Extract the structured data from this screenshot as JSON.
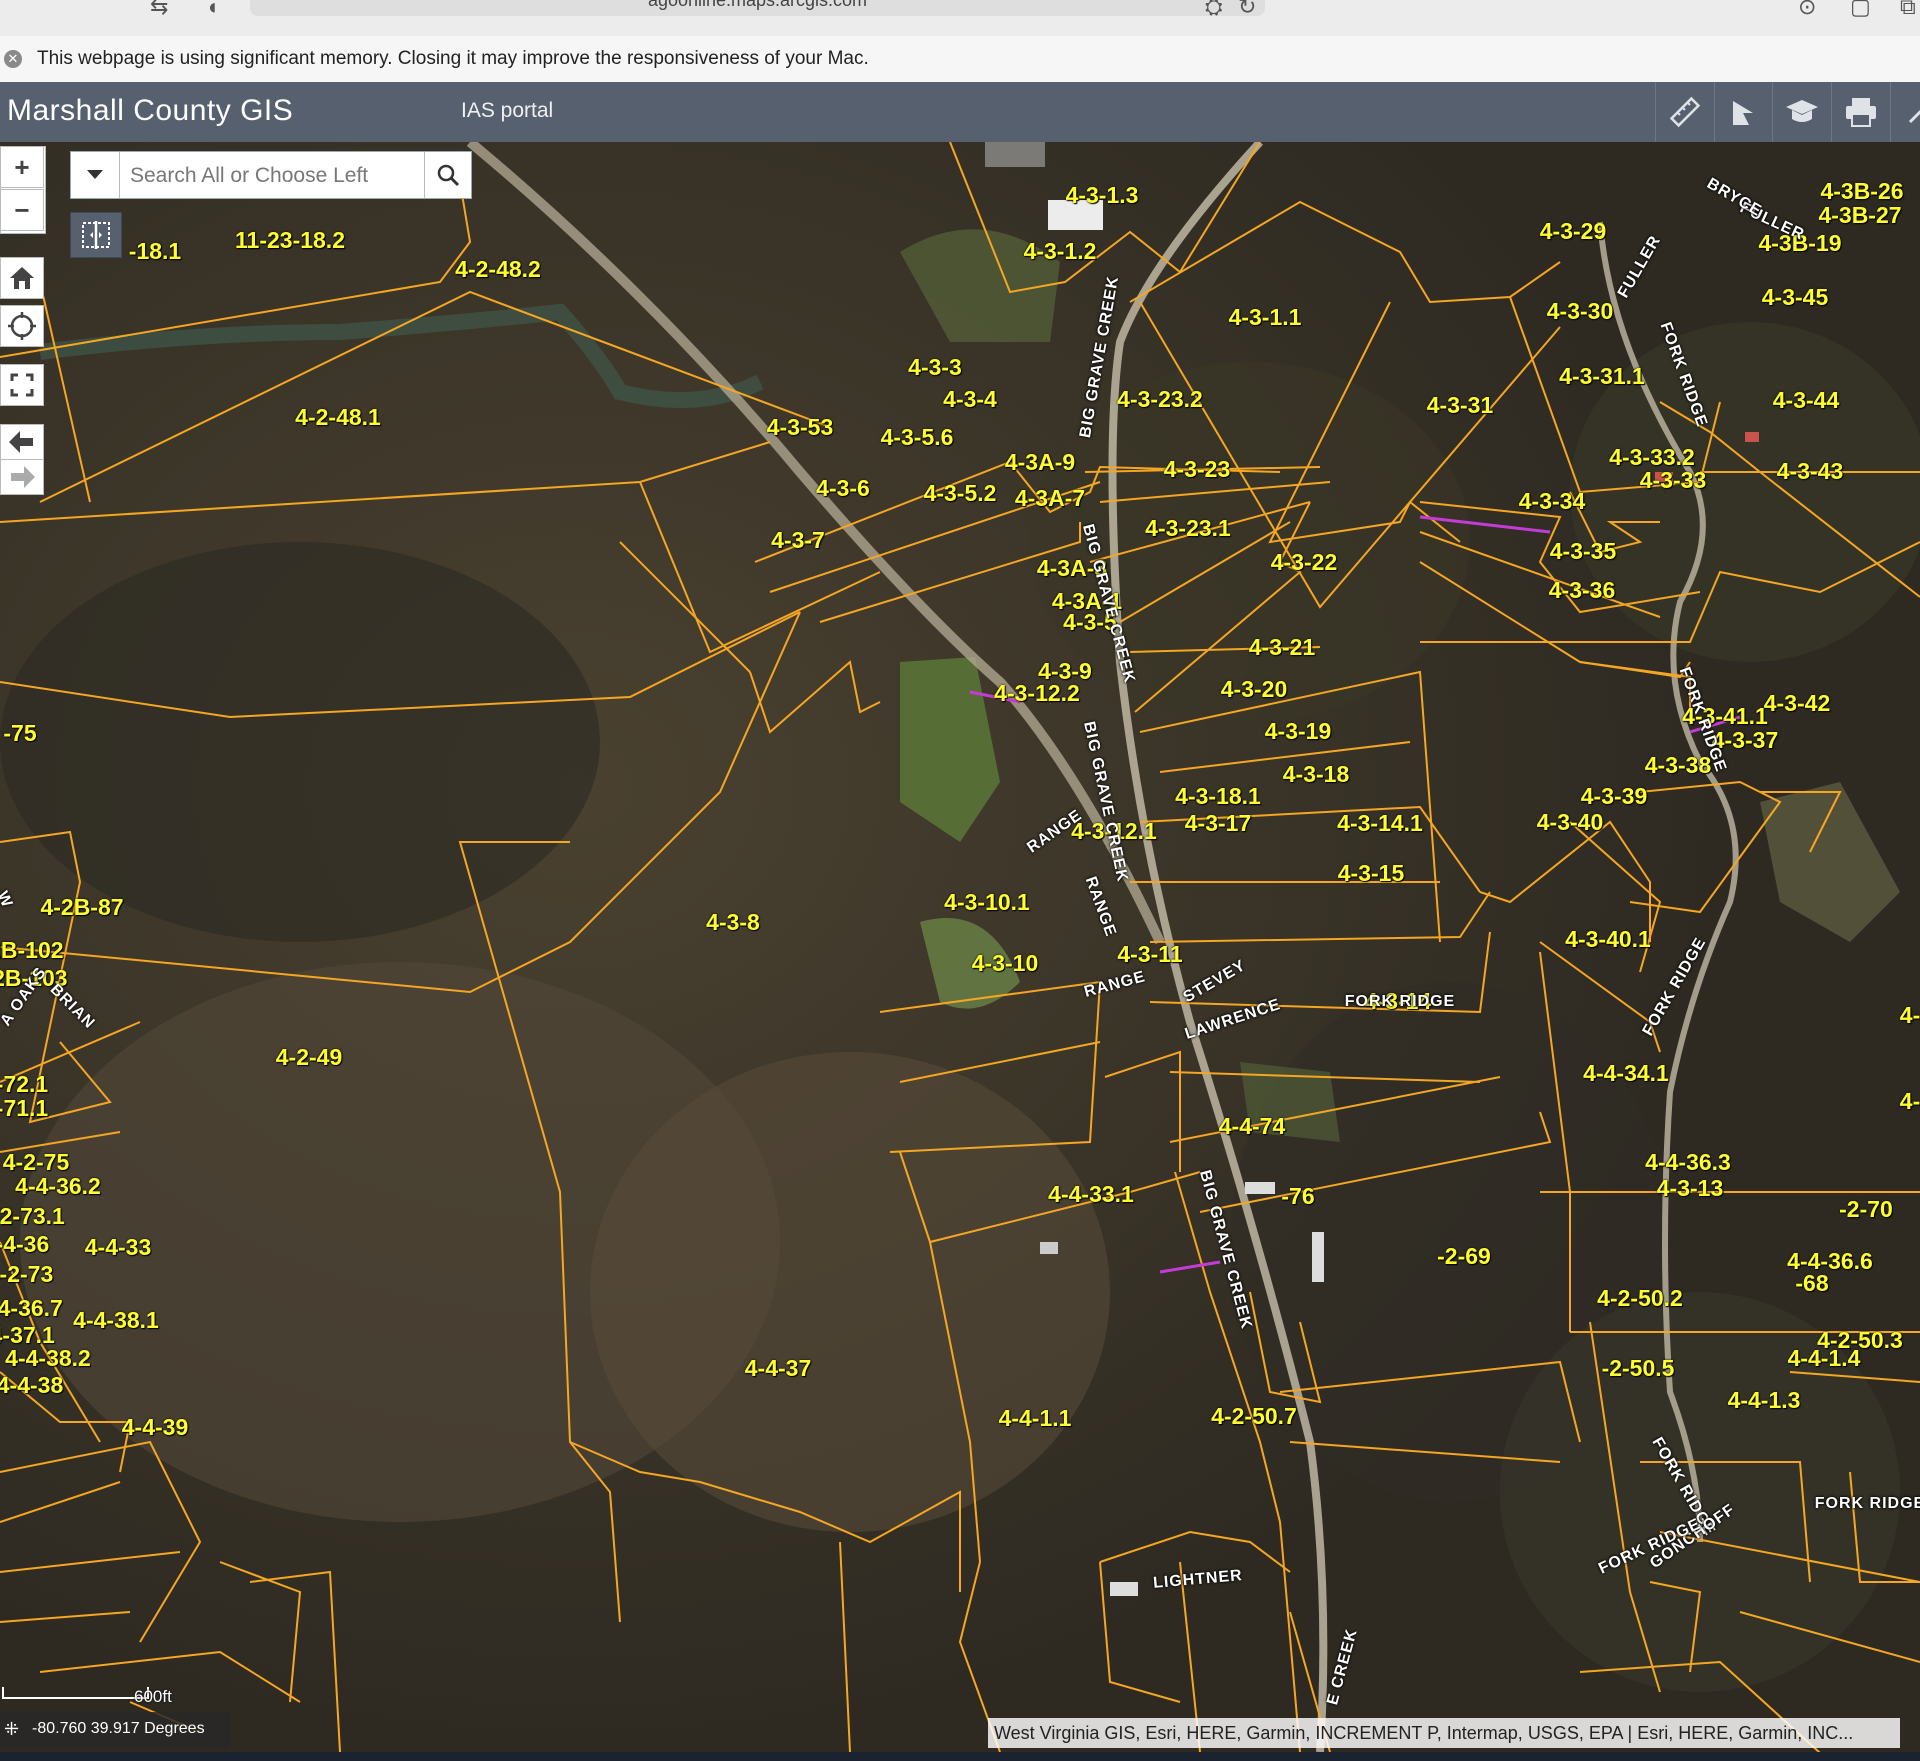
{
  "browser": {
    "url": "agoonline.maps.arcgis.com",
    "notice": "This webpage is using significant memory. Closing it may improve the responsiveness of your Mac."
  },
  "header": {
    "title": "Marshall County GIS",
    "portal_link": "IAS portal",
    "tools": [
      "ruler-icon",
      "measure-tool-icon",
      "graduation-cap-icon",
      "print-icon",
      "expand-icon"
    ]
  },
  "widgets": {
    "zoom_in": "+",
    "zoom_out": "−",
    "search_placeholder": "Search All or Choose Left"
  },
  "map": {
    "scale_label": "600ft",
    "coordinates": "-80.760 39.917 Degrees",
    "attribution": "West Virginia GIS, Esri, HERE, Garmin, INCREMENT P, Intermap, USGS, EPA | Esri, HERE, Garmin, INC...",
    "parcels": [
      "4-3-1.3",
      "4-3-1.2",
      "11-23-18.2",
      "-18.1",
      "4-2-48.2",
      "4-3-1.1",
      "4-3-29",
      "4-3B-26",
      "4-3B-27",
      "4-3B-19",
      "4-3-45",
      "4-3-30",
      "4-3-31.1",
      "4-3-31",
      "4-3-44",
      "4-3-3",
      "4-3-4",
      "4-3-23.2",
      "4-2-48.1",
      "4-3-53",
      "4-3-5.6",
      "4-3A-9",
      "4-3-23",
      "4-3-33.2",
      "4-3-33",
      "4-3-43",
      "4-3-6",
      "4-3-5.2",
      "4-3A-7",
      "4-3-34",
      "4-3-23.1",
      "4-3-7",
      "4-3-35",
      "4-3-22",
      "4-3A-3",
      "4-3-36",
      "4-3A-1",
      "4-3-5",
      "4-3-21",
      "4-3-9",
      "4-3-20",
      "4-3-42",
      "4-3-12.2",
      "4-3-41.1",
      "4-3-19",
      "4-3-37",
      "-75",
      "4-3-38",
      "4-3-18",
      "4-3-18.1",
      "4-3-39",
      "4-3-17",
      "4-3-14.1",
      "4-3-40",
      "4-3-12.1",
      "4-3-15",
      "4-2B-87",
      "4-3-10.1",
      "4-3-8",
      "-2B-102",
      "4-3-40.1",
      "-2B-103",
      "4-3-11",
      "4-3-10",
      "4-3-14",
      "4-",
      "4-2-49",
      "4-4-34.1",
      "-72.1",
      "-71.1",
      "4-",
      "4-4-74",
      "4-2-75",
      "4-4-36.2",
      "4-2-73.1",
      "4-4-36.3",
      "4-3-13",
      "4-4-33.1",
      "-76",
      "4-4-36",
      "-2-70",
      "4-2-73",
      "4-4-33",
      "-2-69",
      "4-4-36.7",
      "4-4-36.6",
      "-68",
      "4-4-37.1",
      "4-2-50.2",
      "4-4-38.1",
      "4-2-50.3",
      "4-4-38.2",
      "4-4-1.4",
      "4-4-37",
      "-2-50.5",
      "4-4-38",
      "4-4-1.3",
      "4-4-1.1",
      "4-2-50.7",
      "4-4-39"
    ],
    "roads": [
      "BIG GRAVE CREEK",
      "BIG GRAVE CREEK",
      "BIG GRAVE CREEK",
      "BIG GRAVE CREEK",
      "FORK RIDGE",
      "FORK RIDGE",
      "FORK RIDGE",
      "FORK RIDGE",
      "FORK RIDGE",
      "FORK RIDGE",
      "FULLER",
      "FULLER",
      "BRYCE",
      "RANGE",
      "RANGE",
      "RANGE",
      "STEVEY",
      "LAWRENCE",
      "LIGHTNER",
      "GONCHOFF",
      "FORK RIDGE",
      "BRIAN",
      "A OAKS",
      "E CREEK",
      "W"
    ]
  }
}
